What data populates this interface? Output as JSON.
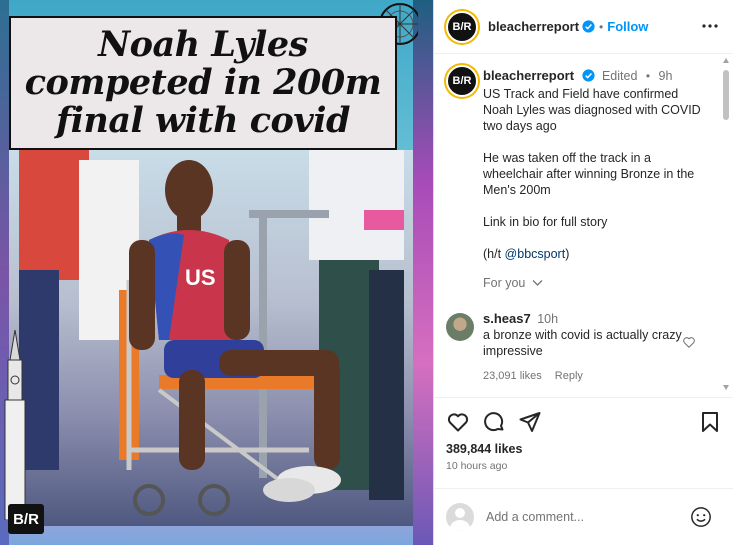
{
  "media": {
    "overlay_headline": "Noah Lyles\ncompeted in 200m\nfinal with covid",
    "jersey_text": "US",
    "watermark": "B/R"
  },
  "header": {
    "username": "bleacherreport",
    "follow_label": "Follow",
    "avatar_text": "B/R"
  },
  "post": {
    "username": "bleacherreport",
    "edited": "Edited",
    "time": "9h",
    "caption_paragraphs": [
      "US Track and Field have confirmed Noah Lyles was diagnosed with COVID two days ago",
      "He was taken off the track in a wheelchair after winning Bronze in the Men's 200m",
      "Link in bio for full story"
    ],
    "hat_tip_prefix": "(h/t ",
    "hat_tip_mention": "@bbcsport",
    "hat_tip_suffix": ")",
    "for_you": "For you"
  },
  "comment": {
    "username": "s.heas7",
    "time": "10h",
    "text": "a bronze with covid is actually crazy impressive",
    "likes": "23,091 likes",
    "reply": "Reply"
  },
  "actions": {
    "like_icon": "heart-icon",
    "comment_icon": "comment-bubble-icon",
    "share_icon": "send-icon",
    "save_icon": "bookmark-icon",
    "likes_count": "389,844 likes",
    "posted_ago": "10 hours ago"
  },
  "add_comment": {
    "placeholder": "Add a comment..."
  },
  "colors": {
    "accent": "#0095f6",
    "verified": "#0095f6",
    "muted": "#737373",
    "text": "#262626"
  }
}
